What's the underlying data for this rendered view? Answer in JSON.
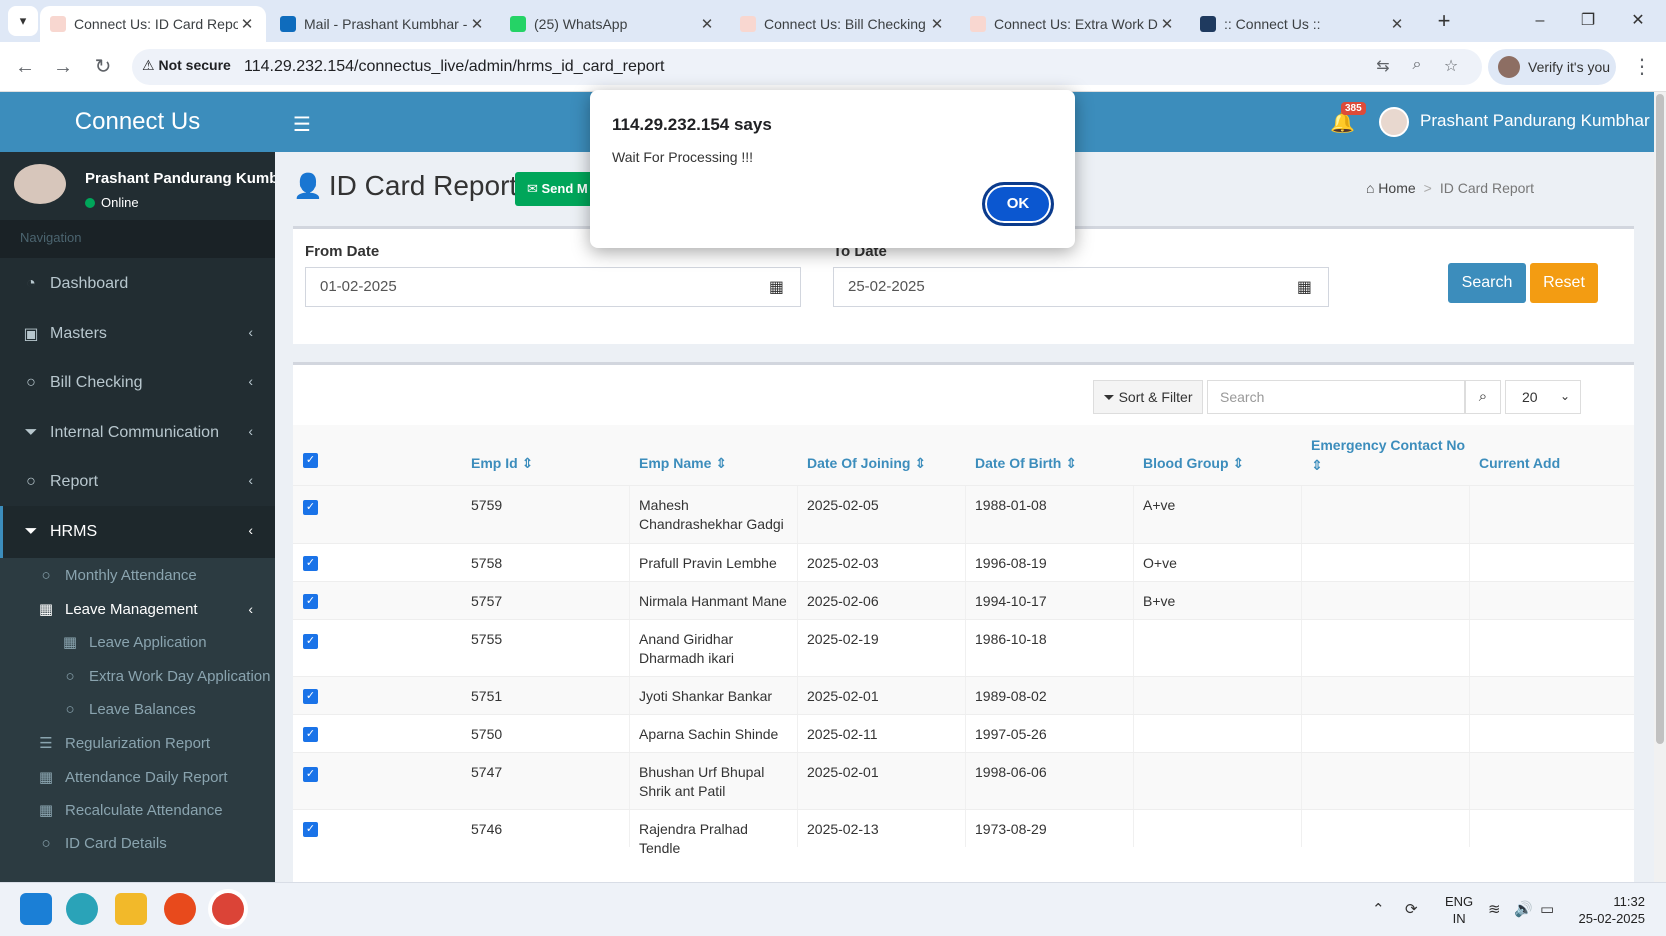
{
  "browser": {
    "tabs": [
      {
        "title": "Connect Us: ID Card Repor",
        "color": "#f8d7d0"
      },
      {
        "title": "Mail - Prashant Kumbhar -",
        "color": "#0f6cbd"
      },
      {
        "title": "(25) WhatsApp",
        "color": "#25d366"
      },
      {
        "title": "Connect Us: Bill Checking T",
        "color": "#f8d7d0"
      },
      {
        "title": "Connect Us: Extra Work Da",
        "color": "#f8d7d0"
      },
      {
        "title": ":: Connect Us ::",
        "color": "#1f3a5f"
      }
    ],
    "security": "Not secure",
    "url": "114.29.232.154/connectus_live/admin/hrms_id_card_report",
    "verify_label": "Verify it's you"
  },
  "app": {
    "brand": "Connect Us",
    "notification_count": "385",
    "header_user": "Prashant Pandurang Kumbhar"
  },
  "sidebar": {
    "user_name": "Prashant Pandurang Kumb",
    "status": "Online",
    "nav_header": "Navigation",
    "items": [
      {
        "label": "Dashboard",
        "icon": "dashboard-icon"
      },
      {
        "label": "Masters",
        "icon": "money-icon"
      },
      {
        "label": "Bill Checking",
        "icon": "circle-icon"
      },
      {
        "label": "Internal Communication",
        "icon": "filter-icon"
      },
      {
        "label": "Report",
        "icon": "circle-icon"
      },
      {
        "label": "HRMS",
        "icon": "filter-icon"
      }
    ],
    "hrms_sub": [
      {
        "label": "Monthly Attendance",
        "icon": "circle-icon"
      },
      {
        "label": "Leave Management",
        "icon": "table-icon"
      },
      {
        "label": "Leave Application",
        "icon": "table-icon"
      },
      {
        "label": "Extra Work Day Application",
        "icon": "circle-icon"
      },
      {
        "label": "Leave Balances",
        "icon": "circle-icon"
      },
      {
        "label": "Regularization Report",
        "icon": "database-icon"
      },
      {
        "label": "Attendance Daily Report",
        "icon": "table-icon"
      },
      {
        "label": "Recalculate Attendance",
        "icon": "table-icon"
      },
      {
        "label": "ID Card Details",
        "icon": "circle-icon"
      }
    ]
  },
  "page": {
    "title": "ID Card Report",
    "send_button": "Send M",
    "breadcrumb_home": "Home",
    "breadcrumb_current": "ID Card Report"
  },
  "filters": {
    "from_label": "From Date",
    "from_value": "01-02-2025",
    "to_label": "To Date",
    "to_value": "25-02-2025",
    "search_button": "Search",
    "reset_button": "Reset"
  },
  "table_tools": {
    "sort_filter": "Sort & Filter",
    "search_placeholder": "Search",
    "page_size": "20"
  },
  "table": {
    "headers": [
      "Emp Id",
      "Emp Name",
      "Date Of Joining",
      "Date Of Birth",
      "Blood Group",
      "Emergency Contact No",
      "Current Add"
    ],
    "rows": [
      {
        "id": "5759",
        "name": "Mahesh Chandrashekhar Gadgi",
        "doj": "2025-02-05",
        "dob": "1988-01-08",
        "blood": "A+ve",
        "emergency": "",
        "address": ""
      },
      {
        "id": "5758",
        "name": "Prafull Pravin Lembhe",
        "doj": "2025-02-03",
        "dob": "1996-08-19",
        "blood": "O+ve",
        "emergency": "",
        "address": ""
      },
      {
        "id": "5757",
        "name": "Nirmala Hanmant Mane",
        "doj": "2025-02-06",
        "dob": "1994-10-17",
        "blood": "B+ve",
        "emergency": "",
        "address": ""
      },
      {
        "id": "5755",
        "name": "Anand Giridhar Dharmadh ikari",
        "doj": "2025-02-19",
        "dob": "1986-10-18",
        "blood": "",
        "emergency": "",
        "address": ""
      },
      {
        "id": "5751",
        "name": "Jyoti Shankar Bankar",
        "doj": "2025-02-01",
        "dob": "1989-08-02",
        "blood": "",
        "emergency": "",
        "address": ""
      },
      {
        "id": "5750",
        "name": "Aparna Sachin Shinde",
        "doj": "2025-02-11",
        "dob": "1997-05-26",
        "blood": "",
        "emergency": "",
        "address": ""
      },
      {
        "id": "5747",
        "name": "Bhushan Urf Bhupal Shrik ant Patil",
        "doj": "2025-02-01",
        "dob": "1998-06-06",
        "blood": "",
        "emergency": "",
        "address": ""
      },
      {
        "id": "5746",
        "name": "Rajendra Pralhad Tendle",
        "doj": "2025-02-13",
        "dob": "1973-08-29",
        "blood": "",
        "emergency": "",
        "address": ""
      }
    ]
  },
  "alert": {
    "title": "114.29.232.154 says",
    "message": "Wait For Processing !!!",
    "ok": "OK"
  },
  "taskbar": {
    "lang_line1": "ENG",
    "lang_line2": "IN",
    "time": "11:32",
    "date": "25-02-2025"
  }
}
